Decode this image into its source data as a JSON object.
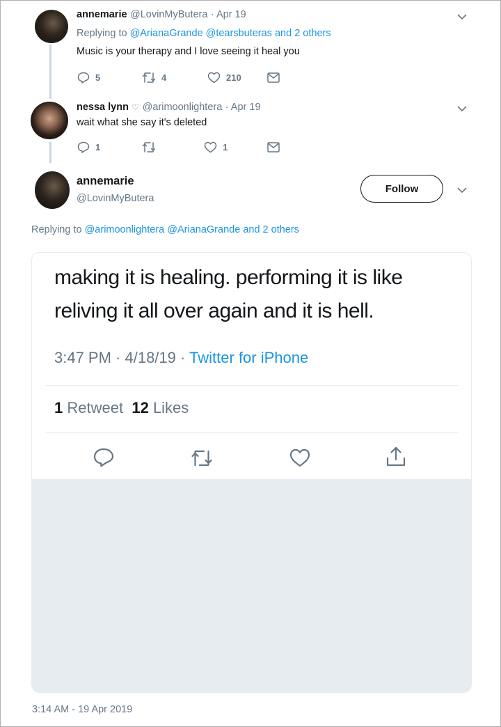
{
  "tweet1": {
    "name": "annemarie",
    "handle": "@LovinMyButera",
    "date": "· Apr 19",
    "replying_prefix": "Replying to",
    "replying_mentions": "@ArianaGrande @tearsbuteras",
    "replying_suffix": "and 2 others",
    "text": "Music is your therapy and I love seeing it heal you",
    "replies": "5",
    "retweets": "4",
    "likes": "210"
  },
  "tweet2": {
    "name": "nessa lynn",
    "heart_glyph": "♡",
    "handle": "@arimoonlightera",
    "date": "· Apr 19",
    "text": "wait what she say it's deleted",
    "replies": "1",
    "retweets": "",
    "likes": "1"
  },
  "tweet3": {
    "name": "annemarie",
    "handle": "@LovinMyButera",
    "follow_label": "Follow",
    "replying_prefix": "Replying to",
    "replying_mentions": "@arimoonlightera @ArianaGrande",
    "replying_suffix": "and 2 others",
    "timestamp": "3:14 AM - 19 Apr 2019"
  },
  "embedded": {
    "line1": "making it is healing. performing it is like",
    "line2": "reliving it all over again and it is hell.",
    "time_date": "3:47 PM · 4/18/19 ·",
    "source": "Twitter for iPhone",
    "retweet_count": "1",
    "retweet_label": "Retweet",
    "likes_count": "12",
    "likes_label": "Likes"
  },
  "icons": {
    "reply": "reply-icon",
    "retweet": "retweet-icon",
    "like": "heart-icon",
    "dm": "envelope-icon",
    "share": "share-icon",
    "more": "chevron-down-icon"
  },
  "colors": {
    "link": "#1b95e0",
    "secondary": "#657786",
    "thread_line": "#ccd6dd",
    "text": "#14171a"
  }
}
